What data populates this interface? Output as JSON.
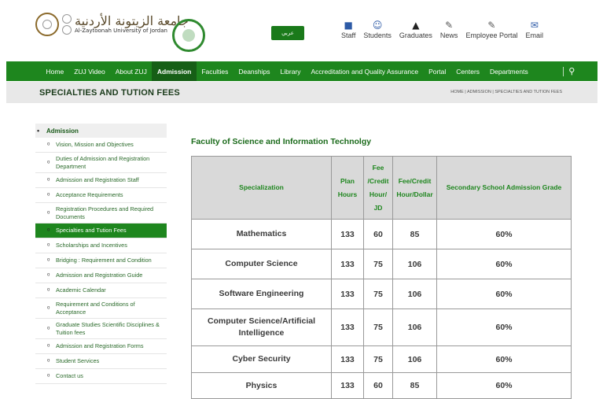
{
  "header": {
    "university_name_en": "Al-Zaytoonah University of Jordan",
    "university_name_ar": "جامعة الزيتونة الأردنية",
    "language_button": "عربي",
    "links": [
      {
        "label": "Staff",
        "icon": "staff-icon"
      },
      {
        "label": "Students",
        "icon": "students-icon"
      },
      {
        "label": "Graduates",
        "icon": "graduates-icon"
      },
      {
        "label": "News",
        "icon": "news-icon"
      },
      {
        "label": "Employee Portal",
        "icon": "employee-portal-icon"
      },
      {
        "label": "Email",
        "icon": "email-icon"
      }
    ]
  },
  "nav": {
    "items": [
      "Home",
      "ZUJ Video",
      "About ZUJ",
      "Admission",
      "Faculties",
      "Deanships",
      "Library",
      "Accreditation and Quality Assurance",
      "Portal",
      "Centers",
      "Departments"
    ],
    "active": "Admission"
  },
  "page": {
    "title": "SPECIALTIES AND TUTION FEES",
    "breadcrumb": "HOME | ADMISSION | SPECIALTIES AND TUTION FEES"
  },
  "sidebar": {
    "heading": "Admission",
    "items": [
      "Vision, Mission and Objectives",
      "Duties of Admission and Registration Department",
      "Admission and Registration Staff",
      "Acceptance Requirements",
      "Registration Procedures and Required Documents",
      "Specialties and Tution Fees",
      "Scholarships and Incentives",
      "Bridging : Requirement and Condition",
      "Admission and Registration Guide",
      "Academic Calendar",
      "Requirement and Conditions of Acceptance",
      "Graduate Studies Scientific Disciplines & Tuition fees",
      "Admission and Registration Forms",
      "Student Services",
      "Contact us"
    ],
    "active_index": 5
  },
  "content": {
    "section_title": "Faculty of Science and Information Technolgy",
    "table": {
      "headers": [
        "Specialization",
        "Plan Hours",
        "Fee /Credit Hour/ JD",
        "Fee/Credit Hour/Dollar",
        "Secondary School Admission Grade"
      ],
      "rows": [
        [
          "Mathematics",
          "133",
          "60",
          "85",
          "60%"
        ],
        [
          "Computer Science",
          "133",
          "75",
          "106",
          "60%"
        ],
        [
          "Software Engineering",
          "133",
          "75",
          "106",
          "60%"
        ],
        [
          "Computer Science/Artificial Intelligence",
          "133",
          "75",
          "106",
          "60%"
        ],
        [
          "Cyber Security",
          "133",
          "75",
          "106",
          "60%"
        ],
        [
          "Physics",
          "133",
          "60",
          "85",
          "60%"
        ]
      ]
    }
  }
}
